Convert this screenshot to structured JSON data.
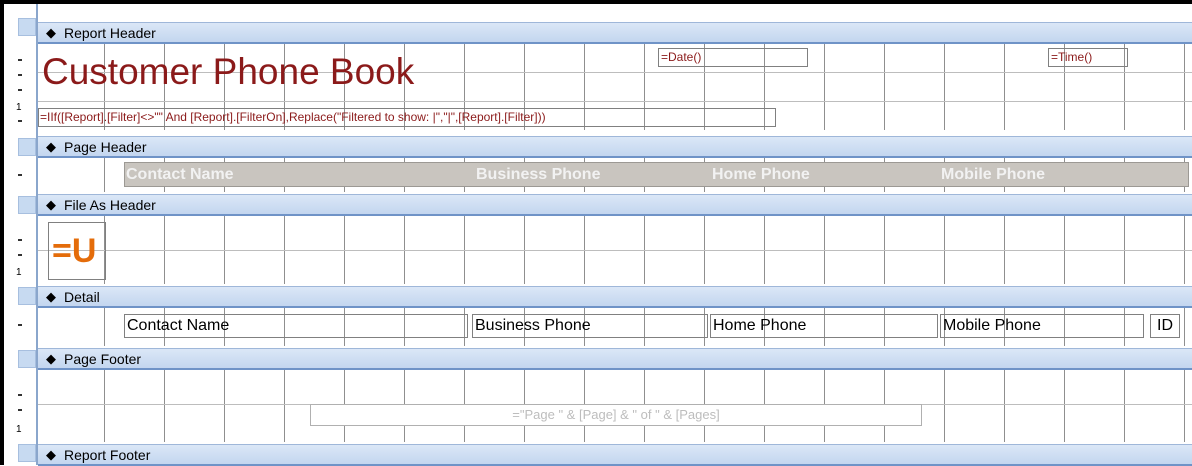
{
  "sections": {
    "report_header": "Report Header",
    "page_header": "Page Header",
    "file_as_header": "File As Header",
    "detail": "Detail",
    "page_footer": "Page Footer",
    "report_footer": "Report Footer"
  },
  "report_header": {
    "title": "Customer Phone Book",
    "date_expr": "=Date()",
    "time_expr": "=Time()",
    "filter_expr": "=IIf([Report].[Filter]<>\"\" And [Report].[FilterOn],Replace(\"Filtered to show: |\",\"|\",[Report].[Filter]))"
  },
  "page_header": {
    "columns": [
      "Contact Name",
      "Business Phone",
      "Home Phone",
      "Mobile Phone"
    ]
  },
  "file_as_header": {
    "expr": "=U"
  },
  "detail": {
    "fields": [
      "Contact Name",
      "Business Phone",
      "Home Phone",
      "Mobile Phone",
      "ID"
    ]
  },
  "page_footer": {
    "page_expr": "=\"Page \" & [Page] & \" of \" & [Pages]"
  },
  "ruler": {
    "mark_one": "1"
  },
  "colors": {
    "title": "#8b1a1a",
    "header_bg": "#c9c5bf",
    "header_text": "#f2f2f2",
    "accent_orange": "#e46c0a",
    "band_bg": "#c3d6ef"
  }
}
